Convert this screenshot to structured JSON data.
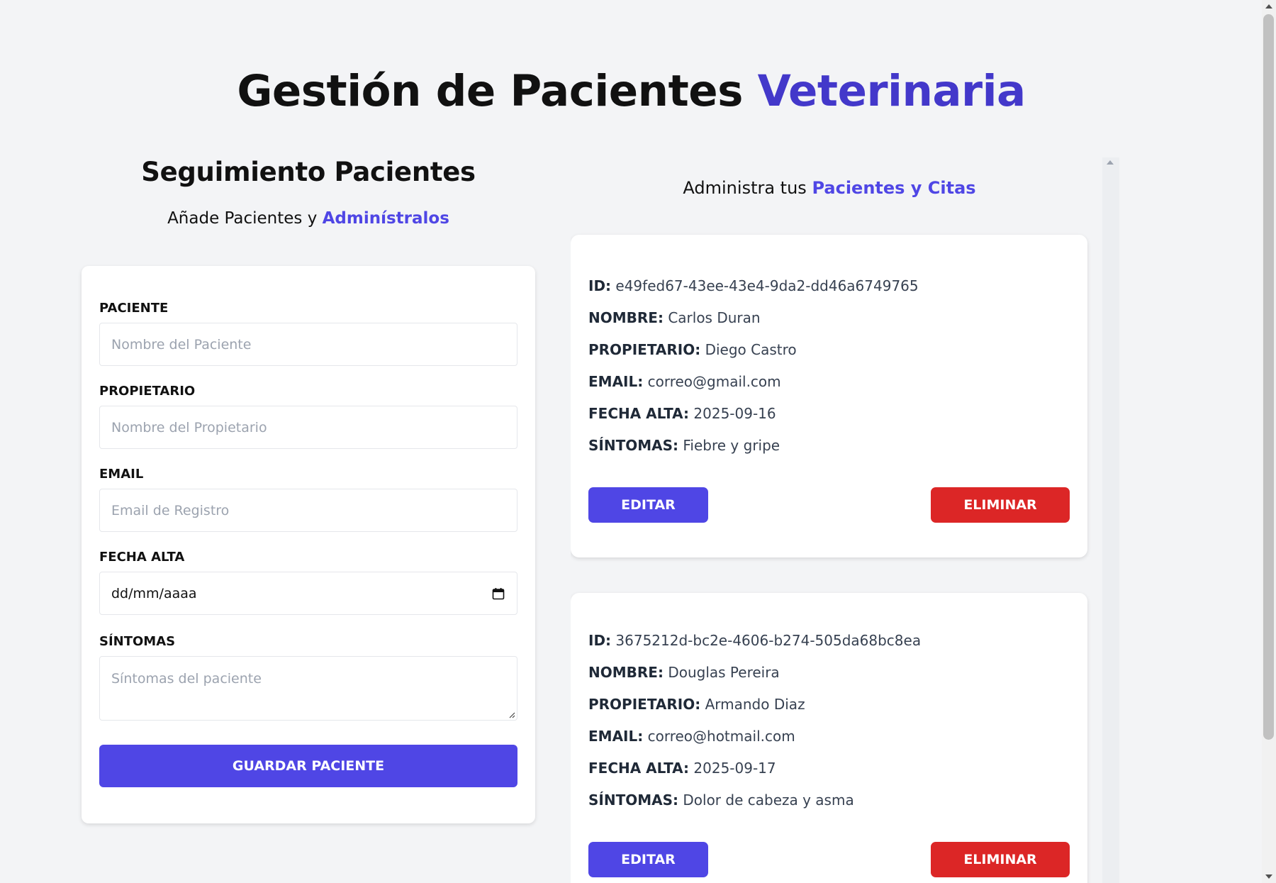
{
  "header": {
    "title_main": "Gestión de Pacientes",
    "title_accent": "Veterinaria"
  },
  "form_section": {
    "heading": "Seguimiento Pacientes",
    "subtitle_prefix": "Añade Pacientes y",
    "subtitle_accent": "Adminístralos",
    "fields": {
      "paciente": {
        "label": "PACIENTE",
        "placeholder": "Nombre del Paciente"
      },
      "propietario": {
        "label": "PROPIETARIO",
        "placeholder": "Nombre del Propietario"
      },
      "email": {
        "label": "EMAIL",
        "placeholder": "Email de Registro"
      },
      "fecha": {
        "label": "FECHA ALTA",
        "value": "dd/mm/aaaa"
      },
      "sintomas": {
        "label": "SÍNTOMAS",
        "placeholder": "Síntomas del paciente"
      }
    },
    "submit_label": "GUARDAR PACIENTE"
  },
  "list_section": {
    "subtitle_prefix": "Administra tus",
    "subtitle_accent": "Pacientes y Citas",
    "labels": {
      "id": "ID:",
      "nombre": "NOMBRE:",
      "propietario": "PROPIETARIO:",
      "email": "EMAIL:",
      "fecha": "FECHA ALTA:",
      "sintomas": "SÍNTOMAS:"
    },
    "edit_label": "EDITAR",
    "delete_label": "ELIMINAR",
    "patients": [
      {
        "id": "e49fed67-43ee-43e4-9da2-dd46a6749765",
        "nombre": "Carlos Duran",
        "propietario": "Diego Castro",
        "email": "correo@gmail.com",
        "fecha": "2025-09-16",
        "sintomas": "Fiebre y gripe"
      },
      {
        "id": "3675212d-bc2e-4606-b274-505da68bc8ea",
        "nombre": "Douglas Pereira",
        "propietario": "Armando Diaz",
        "email": "correo@hotmail.com",
        "fecha": "2025-09-17",
        "sintomas": "Dolor de cabeza y asma"
      }
    ]
  },
  "colors": {
    "accent": "#4f46e5",
    "danger": "#dc2626",
    "background": "#f3f4f6"
  }
}
